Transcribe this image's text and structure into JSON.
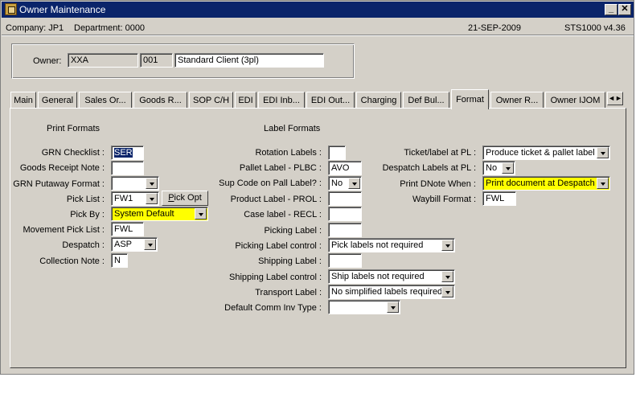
{
  "window": {
    "title": "Owner Maintenance",
    "minimize_label": "_",
    "close_label": "✕"
  },
  "status": {
    "company": "Company:  JP1",
    "department": "Department:  0000",
    "date": "21-SEP-2009",
    "version": "STS1000  v4.36"
  },
  "owner": {
    "label": "Owner:",
    "code": "XXA",
    "number": "001",
    "name": "Standard Client (3pl)"
  },
  "tabs": [
    "Main",
    "General",
    "Sales Or...",
    "Goods R...",
    "SOP C/H",
    "EDI",
    "EDI Inb...",
    "EDI Out...",
    "Charging",
    "Def Bul...",
    "Format",
    "Owner R...",
    "Owner IJOM"
  ],
  "active_tab": "Format",
  "tab_scroll_label": "◄►",
  "print_formats": {
    "heading": "Print Formats",
    "grn_checklist": {
      "label": "GRN Checklist :",
      "value": "SER"
    },
    "goods_receipt_note": {
      "label": "Goods Receipt Note :",
      "value": ""
    },
    "grn_putaway_format": {
      "label": "GRN Putaway Format :",
      "value": ""
    },
    "pick_list": {
      "label": "Pick List :",
      "value": "FW1"
    },
    "pick_opt_button": {
      "prefix": "P",
      "rest": "ick Opt"
    },
    "pick_by": {
      "label": "Pick By :",
      "value": "System Default"
    },
    "movement_pick_list": {
      "label": "Movement Pick List :",
      "value": "FWL"
    },
    "despatch": {
      "label": "Despatch :",
      "value": "ASP"
    },
    "collection_note": {
      "label": "Collection Note :",
      "value": "N"
    }
  },
  "label_formats": {
    "heading": "Label Formats",
    "rotation_labels": {
      "label": "Rotation Labels :",
      "value": ""
    },
    "pallet_label": {
      "label": "Pallet Label - PLBC :",
      "value": "AVO"
    },
    "sup_code_on_pall": {
      "label": "Sup Code on Pall Label? :",
      "value": "No"
    },
    "product_label": {
      "label": "Product Label - PROL :",
      "value": ""
    },
    "case_label": {
      "label": "Case label - RECL :",
      "value": ""
    },
    "picking_label": {
      "label": "Picking Label :",
      "value": ""
    },
    "picking_label_control": {
      "label": "Picking Label control :",
      "value": "Pick labels not required"
    },
    "shipping_label": {
      "label": "Shipping Label :",
      "value": ""
    },
    "shipping_label_control": {
      "label": "Shipping Label control :",
      "value": "Ship labels not required"
    },
    "transport_label": {
      "label": "Transport Label :",
      "value": "No simplified labels required"
    },
    "default_comm_inv_type": {
      "label": "Default Comm Inv Type :",
      "value": ""
    }
  },
  "right_column": {
    "ticket_label_at_pl": {
      "label": "Ticket/label at PL :",
      "value": "Produce ticket & pallet label"
    },
    "despatch_labels_at_pl": {
      "label": "Despatch Labels at PL :",
      "value": "No"
    },
    "print_dnote_when": {
      "label": "Print DNote When :",
      "value": "Print document at Despatch"
    },
    "waybill_format": {
      "label": "Waybill Format :",
      "value": "FWL"
    }
  },
  "colors": {
    "face": "#d4d0c8",
    "titlebar": "#0a246a",
    "highlight_field": "#ffff00"
  }
}
